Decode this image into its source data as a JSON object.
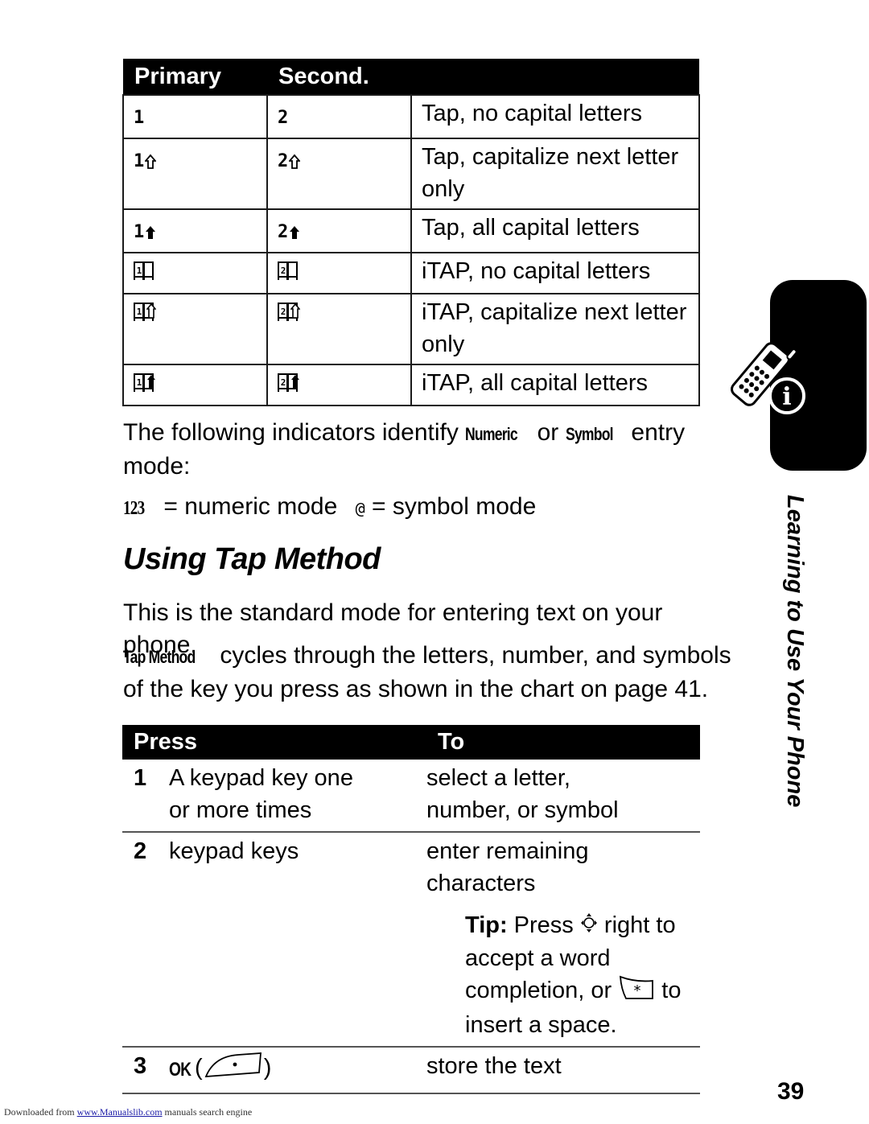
{
  "mode_table": {
    "headers": [
      "Primary",
      "Second.",
      ""
    ],
    "rows": [
      {
        "primary": {
          "digit": "1",
          "indicator": "none"
        },
        "secondary": {
          "digit": "2",
          "indicator": "none"
        },
        "description": "Tap, no capital letters"
      },
      {
        "primary": {
          "digit": "1",
          "indicator": "shift-outline-arrow"
        },
        "secondary": {
          "digit": "2",
          "indicator": "shift-outline-arrow"
        },
        "description": "Tap, capitalize next letter only"
      },
      {
        "primary": {
          "digit": "1",
          "indicator": "caps-solid-arrow"
        },
        "secondary": {
          "digit": "2",
          "indicator": "caps-solid-arrow"
        },
        "description": "Tap, all capital letters"
      },
      {
        "primary": {
          "digit": "1",
          "indicator": "itap-book"
        },
        "secondary": {
          "digit": "2",
          "indicator": "itap-book"
        },
        "description": "iTAP, no capital letters"
      },
      {
        "primary": {
          "digit": "1",
          "indicator": "itap-book-shift"
        },
        "secondary": {
          "digit": "2",
          "indicator": "itap-book-shift"
        },
        "description": "iTAP, capitalize next letter only"
      },
      {
        "primary": {
          "digit": "1",
          "indicator": "itap-book-caps"
        },
        "secondary": {
          "digit": "2",
          "indicator": "itap-book-caps"
        },
        "description": "iTAP, all capital letters"
      }
    ]
  },
  "indicators_para": {
    "before": "The following indicators identify ",
    "term1": "Numeric",
    "middle": " or ",
    "term2": "Symbol",
    "after": " entry mode:"
  },
  "mode_legend": {
    "numeric_glyph": "123",
    "numeric_text": " = numeric mode",
    "symbol_glyph": "@",
    "symbol_text": " = symbol mode"
  },
  "section": {
    "title": "Using Tap Method",
    "intro": "This is the standard mode for entering text on your phone.",
    "desc_term": "Tap Method",
    "desc_text": " cycles through the letters, number, and symbols of the key you press as shown in the chart on page 41."
  },
  "press_table": {
    "headers": {
      "press": "Press",
      "to": "To"
    },
    "rows": [
      {
        "num": "1",
        "press": "A keypad key one or more times",
        "to": "select a letter, number, or symbol"
      },
      {
        "num": "2",
        "press": "keypad keys",
        "to": "enter remaining characters",
        "tip": {
          "label": "Tip:",
          "part1": " Press ",
          "nav_key": "nav-key",
          "part2": " right to accept a word completion, or ",
          "star_key": "*",
          "part3": " to insert a space."
        }
      },
      {
        "num": "3",
        "press_term": "OK",
        "press_paren_open": " (",
        "press_key": "left-soft-key",
        "press_paren_close": ")",
        "to": "store the text"
      }
    ]
  },
  "side_tab": {
    "label": "Learning to Use Your Phone"
  },
  "page_number": "39",
  "footer": {
    "prefix": "Downloaded from ",
    "link": "www.Manualslib.com",
    "suffix": " manuals search engine"
  }
}
